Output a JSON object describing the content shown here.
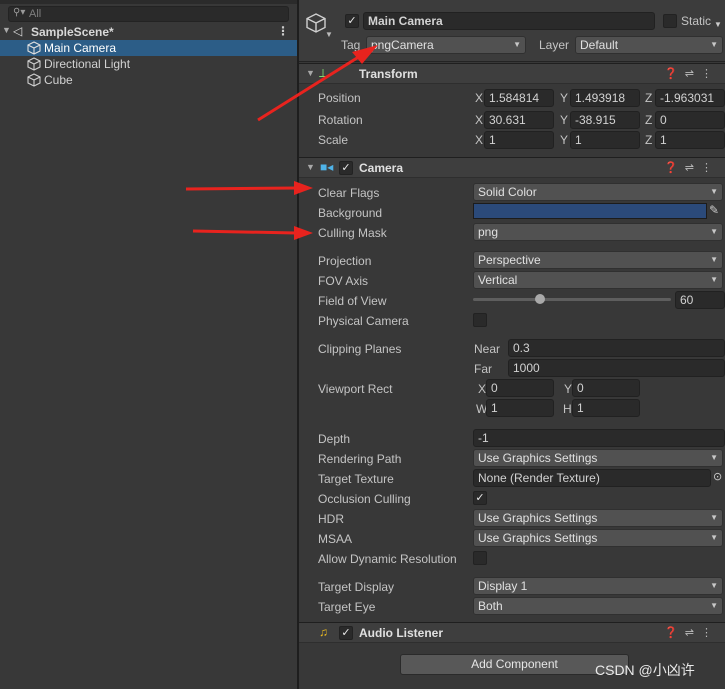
{
  "hierarchy": {
    "search_placeholder": "All",
    "scene_name": "SampleScene*",
    "menu_glyph": "⋮",
    "items": [
      {
        "label": "Main Camera",
        "selected": true
      },
      {
        "label": "Directional Light",
        "selected": false
      },
      {
        "label": "Cube",
        "selected": false
      }
    ]
  },
  "inspector": {
    "object_name": "Main Camera",
    "static_label": "Static",
    "tag_label": "Tag",
    "tag_value": "pngCamera",
    "layer_label": "Layer",
    "layer_value": "Default",
    "transform": {
      "title": "Transform",
      "position_label": "Position",
      "rotation_label": "Rotation",
      "scale_label": "Scale",
      "position": {
        "x": "1.584814",
        "y": "1.493918",
        "z": "-1.963031"
      },
      "rotation": {
        "x": "30.631",
        "y": "-38.915",
        "z": "0"
      },
      "scale": {
        "x": "1",
        "y": "1",
        "z": "1"
      }
    },
    "camera": {
      "title": "Camera",
      "clear_flags_label": "Clear Flags",
      "clear_flags": "Solid Color",
      "background_label": "Background",
      "background_color": "#2b4a7a",
      "culling_mask_label": "Culling Mask",
      "culling_mask": "png",
      "projection_label": "Projection",
      "projection": "Perspective",
      "fov_axis_label": "FOV Axis",
      "fov_axis": "Vertical",
      "fov_label": "Field of View",
      "fov_value": "60",
      "physical_label": "Physical Camera",
      "clipping_label": "Clipping Planes",
      "near_label": "Near",
      "near": "0.3",
      "far_label": "Far",
      "far": "1000",
      "viewport_label": "Viewport Rect",
      "vp_x": "0",
      "vp_y": "0",
      "vp_w": "1",
      "vp_h": "1",
      "depth_label": "Depth",
      "depth": "-1",
      "rendering_path_label": "Rendering Path",
      "rendering_path": "Use Graphics Settings",
      "target_texture_label": "Target Texture",
      "target_texture": "None (Render Texture)",
      "occlusion_label": "Occlusion Culling",
      "hdr_label": "HDR",
      "hdr": "Use Graphics Settings",
      "msaa_label": "MSAA",
      "msaa": "Use Graphics Settings",
      "dyn_res_label": "Allow Dynamic Resolution",
      "target_display_label": "Target Display",
      "target_display": "Display 1",
      "target_eye_label": "Target Eye",
      "target_eye": "Both"
    },
    "audio_listener_title": "Audio Listener",
    "add_component": "Add Component"
  },
  "axes": {
    "x": "X",
    "y": "Y",
    "z": "Z",
    "w": "W",
    "h": "H"
  },
  "watermark": "CSDN @小凶许",
  "colors": {
    "selection": "#2c5d87",
    "annotation_arrow": "#e8231e",
    "camera_icon": "#4fb3e8",
    "audio_icon": "#e8b820"
  }
}
